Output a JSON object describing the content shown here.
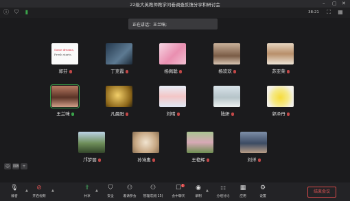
{
  "window": {
    "title": "22级大英教师教学问卷调查反馈分享和研讨会"
  },
  "toolbar": {
    "timer": "38:21"
  },
  "speaking": {
    "text": "正在讲话：王兰咪;"
  },
  "participants": [
    {
      "name": "郭芬",
      "mic": "muted",
      "thumb": "card",
      "active": false
    },
    {
      "name": "丁克霞",
      "mic": "muted",
      "thumb": "dark-blue",
      "active": false
    },
    {
      "name": "杨佩聪",
      "mic": "muted",
      "thumb": "pink-rose",
      "active": false
    },
    {
      "name": "杨欢欢",
      "mic": "muted",
      "thumb": "girl-photo",
      "active": false
    },
    {
      "name": "苏亚荣",
      "mic": "muted",
      "thumb": "bookshelf",
      "active": false
    },
    {
      "name": "王兰咪",
      "mic": "on",
      "thumb": "woman-portrait",
      "active": true
    },
    {
      "name": "凡晨阳",
      "mic": "muted",
      "thumb": "golden",
      "active": false
    },
    {
      "name": "刘晴",
      "mic": "muted",
      "thumb": "cartoon",
      "active": false
    },
    {
      "name": "陆妍",
      "mic": "muted",
      "thumb": "angel-art",
      "active": false
    },
    {
      "name": "郭泽丹",
      "mic": "muted",
      "thumb": "pikachu",
      "active": false
    },
    {
      "name": "邝梦丽",
      "mic": "muted",
      "thumb": "outdoor",
      "active": false
    },
    {
      "name": "孙诗惠",
      "mic": "muted",
      "thumb": "cat",
      "active": false
    },
    {
      "name": "王艳辉",
      "mic": "muted",
      "thumb": "garden",
      "active": false
    },
    {
      "name": "刘洋",
      "mic": "muted",
      "thumb": "child-photo",
      "active": false
    }
  ],
  "bottombar": {
    "mute": "静音",
    "video": "开启视频",
    "share": "共享",
    "security": "安全",
    "invite": "邀请参会",
    "manage": "管理成员(15)",
    "chat": "会中聊天",
    "record": "录制",
    "breakout": "分组讨论",
    "apps": "应用",
    "settings": "设置",
    "chat_badge": "1",
    "end": "结束会议"
  },
  "thumb_card_text": {
    "line1": "Some dreams,",
    "line2": "Fresh starts."
  }
}
